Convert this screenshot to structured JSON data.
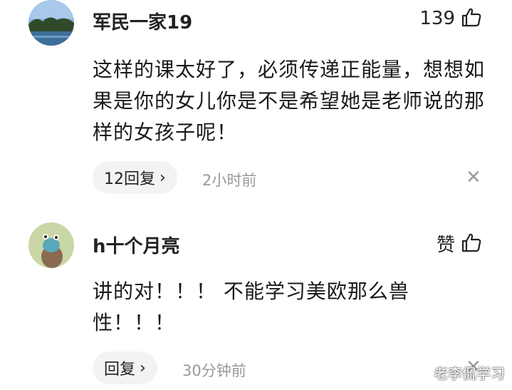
{
  "comments": [
    {
      "username": "军民一家19",
      "like_count": "139",
      "text": "这样的课太好了，必须传递正能量，想想如果是你的女儿你是不是希望她是老师说的那样的女孩子呢！",
      "reply_label": "12回复",
      "time": "2小时前",
      "avatar_icon": "landscape-avatar-icon"
    },
    {
      "username": "h十个月亮",
      "like_count": "赞",
      "text": "讲的对！！！ 不能学习美欧那么兽性！！！",
      "reply_label": "回复",
      "time": "30分钟前",
      "avatar_icon": "cartoon-avatar-icon"
    }
  ],
  "watermark": "老李侃学习",
  "icons": {
    "like": "thumbs-up-icon",
    "chevron": "chevron-right-icon",
    "close": "close-icon"
  },
  "colors": {
    "reply_bg": "#f3f3f3",
    "meta_text": "#999999"
  }
}
